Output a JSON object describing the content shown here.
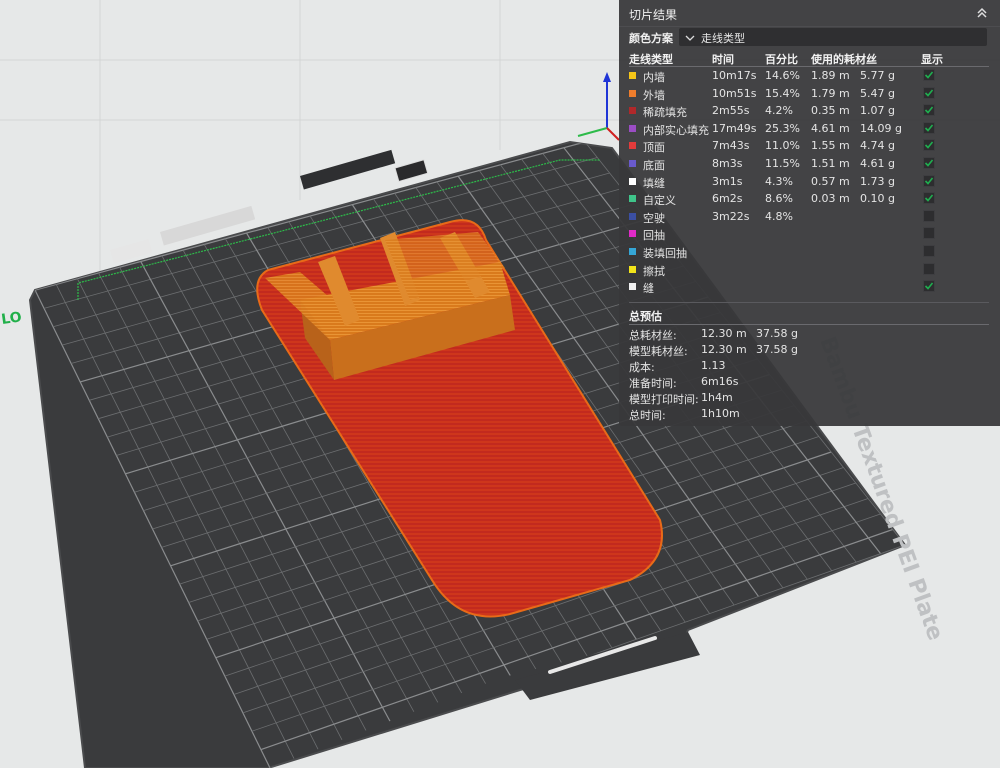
{
  "panel": {
    "title": "切片结果",
    "collapse_icon": "chevron-double-up-icon",
    "color_scheme": {
      "label": "颜色方案",
      "value": "走线类型"
    },
    "columns": [
      "走线类型",
      "时间",
      "百分比",
      "使用的耗材丝",
      "显示"
    ],
    "rows": [
      {
        "name": "内墙",
        "color": "#f5c518",
        "time": "10m17s",
        "percent": "14.6%",
        "length": "1.89 m",
        "weight": "5.77 g",
        "visible": true
      },
      {
        "name": "外墙",
        "color": "#ef7d2c",
        "time": "10m51s",
        "percent": "15.4%",
        "length": "1.79 m",
        "weight": "5.47 g",
        "visible": true
      },
      {
        "name": "稀疏填充",
        "color": "#b0282a",
        "time": "2m55s",
        "percent": "4.2%",
        "length": "0.35 m",
        "weight": "1.07 g",
        "visible": true
      },
      {
        "name": "内部实心填充",
        "color": "#9b4dc4",
        "time": "17m49s",
        "percent": "25.3%",
        "length": "4.61 m",
        "weight": "14.09 g",
        "visible": true
      },
      {
        "name": "顶面",
        "color": "#e23b3b",
        "time": "7m43s",
        "percent": "11.0%",
        "length": "1.55 m",
        "weight": "4.74 g",
        "visible": true
      },
      {
        "name": "底面",
        "color": "#6a5acd",
        "time": "8m3s",
        "percent": "11.5%",
        "length": "1.51 m",
        "weight": "4.61 g",
        "visible": true
      },
      {
        "name": "填缝",
        "color": "#ffffff",
        "time": "3m1s",
        "percent": "4.3%",
        "length": "0.57 m",
        "weight": "1.73 g",
        "visible": true
      },
      {
        "name": "自定义",
        "color": "#3fc48a",
        "time": "6m2s",
        "percent": "8.6%",
        "length": "0.03 m",
        "weight": "0.10 g",
        "visible": true
      },
      {
        "name": "空驶",
        "color": "#3b4fa3",
        "time": "3m22s",
        "percent": "4.8%",
        "length": "",
        "weight": "",
        "visible": false
      },
      {
        "name": "回抽",
        "color": "#e02ac8",
        "time": "",
        "percent": "",
        "length": "",
        "weight": "",
        "visible": false
      },
      {
        "name": "装填回抽",
        "color": "#35a6d6",
        "time": "",
        "percent": "",
        "length": "",
        "weight": "",
        "visible": false
      },
      {
        "name": "擦拭",
        "color": "#f2e41a",
        "time": "",
        "percent": "",
        "length": "",
        "weight": "",
        "visible": false
      },
      {
        "name": "缝",
        "color": "#f0f0f0",
        "time": "",
        "percent": "",
        "length": "",
        "weight": "",
        "visible": true
      }
    ],
    "estimate": {
      "title": "总预估",
      "rows": [
        {
          "label": "总耗材丝:",
          "v1": "12.30 m",
          "v2": "37.58 g"
        },
        {
          "label": "模型耗材丝:",
          "v1": "12.30 m",
          "v2": "37.58 g"
        },
        {
          "label": "成本:",
          "v1": "1.13",
          "v2": ""
        },
        {
          "label": "准备时间:",
          "v1": "6m16s",
          "v2": ""
        },
        {
          "label": "模型打印时间:",
          "v1": "1h4m",
          "v2": ""
        },
        {
          "label": "总时间:",
          "v1": "1h10m",
          "v2": ""
        }
      ]
    }
  },
  "scene": {
    "bed_label": "Bambu Textured PEI Plate",
    "axis_label": "LO",
    "bed_color": "#3d3e40",
    "model_colors": {
      "bottom": "#c0271e",
      "walls": "#d8781e"
    }
  }
}
